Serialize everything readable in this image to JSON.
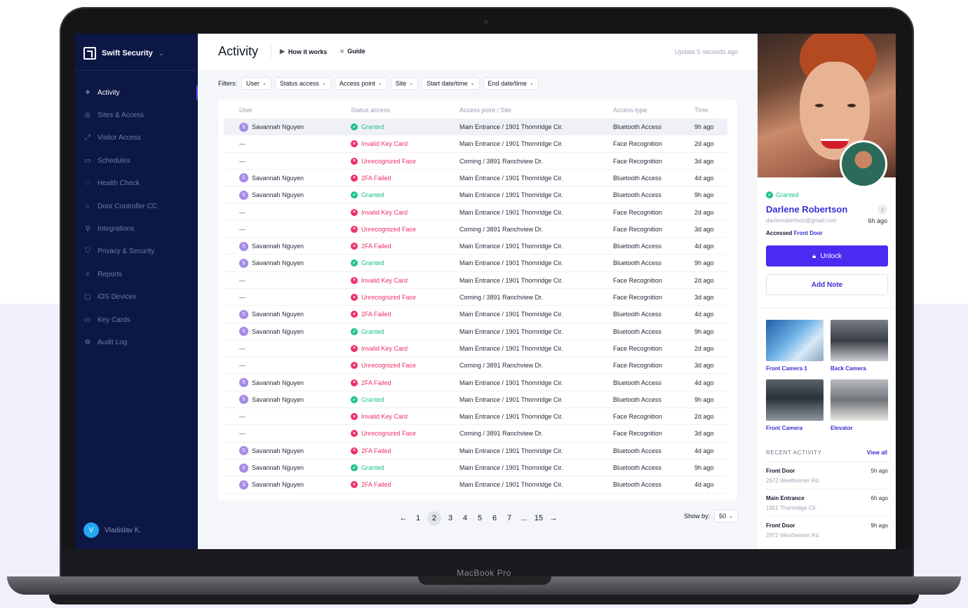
{
  "device_label": "MacBook Pro",
  "brand": {
    "name": "Swift Security"
  },
  "nav": [
    {
      "label": "Activity",
      "icon": "activity-icon",
      "glyph": "✧",
      "active": true
    },
    {
      "label": "Sites & Access",
      "icon": "location-icon",
      "glyph": "◎"
    },
    {
      "label": "Visitor Access",
      "icon": "visitor-icon",
      "glyph": "⤢"
    },
    {
      "label": "Schedules",
      "icon": "calendar-icon",
      "glyph": "▭"
    },
    {
      "label": "Health Check",
      "icon": "heart-icon",
      "glyph": "♡"
    },
    {
      "label": "Door Controller CC",
      "icon": "lock-icon",
      "glyph": "⌂"
    },
    {
      "label": "Integrations",
      "icon": "plug-icon",
      "glyph": "⚲"
    },
    {
      "label": "Privacy & Security",
      "icon": "shield-icon",
      "glyph": "⛉"
    },
    {
      "label": "Reports",
      "icon": "reports-icon",
      "glyph": "✧"
    },
    {
      "label": "iOS Devices",
      "icon": "device-icon",
      "glyph": "▢"
    },
    {
      "label": "Key Cards",
      "icon": "card-icon",
      "glyph": "▭"
    },
    {
      "label": "Audit Log",
      "icon": "gear-icon",
      "glyph": "⚙"
    }
  ],
  "current_user": {
    "initial": "V",
    "name": "Vladislav K."
  },
  "header": {
    "title": "Activity",
    "how_it_works": "How it works",
    "guide": "Guide",
    "update_status": "Update 5 seconds ago"
  },
  "filters": {
    "label": "Filters:",
    "chips": [
      "User",
      "Status access",
      "Access point",
      "Site",
      "Start date/time",
      "End date/time"
    ]
  },
  "table": {
    "columns": [
      "User",
      "Status access",
      "Access point / Site",
      "Access type",
      "Time"
    ],
    "rows": [
      {
        "user": "Savannah Nguyen",
        "initial": "S",
        "status": "Granted",
        "kind": "ok",
        "point": "Main Entrance / 1901 Thornridge Cir.",
        "type": "Bluetooth Access",
        "time": "9h ago"
      },
      {
        "user": "—",
        "initial": "",
        "status": "Invalid Key Card",
        "kind": "bad",
        "point": "Main Entrance / 1901 Thornridge Cir.",
        "type": "Face Recognition",
        "time": "2d ago"
      },
      {
        "user": "—",
        "initial": "",
        "status": "Unrecognized Face",
        "kind": "bad",
        "point": "Coming / 3891 Ranchview Dr.",
        "type": "Face Recognition",
        "time": "3d ago"
      },
      {
        "user": "Savannah Nguyen",
        "initial": "S",
        "status": "2FA Failed",
        "kind": "bad",
        "point": "Main Entrance / 1901 Thornridge Cir.",
        "type": "Bluetooth Access",
        "time": "4d ago"
      },
      {
        "user": "Savannah Nguyen",
        "initial": "S",
        "status": "Granted",
        "kind": "ok",
        "point": "Main Entrance / 1901 Thornridge Cir.",
        "type": "Bluetooth Access",
        "time": "9h ago"
      },
      {
        "user": "—",
        "initial": "",
        "status": "Invalid Key Card",
        "kind": "bad",
        "point": "Main Entrance / 1901 Thornridge Cir.",
        "type": "Face Recognition",
        "time": "2d ago"
      },
      {
        "user": "—",
        "initial": "",
        "status": "Unrecognized Face",
        "kind": "bad",
        "point": "Coming / 3891 Ranchview Dr.",
        "type": "Face Recognition",
        "time": "3d ago"
      },
      {
        "user": "Savannah Nguyen",
        "initial": "S",
        "status": "2FA Failed",
        "kind": "bad",
        "point": "Main Entrance / 1901 Thornridge Cir.",
        "type": "Bluetooth Access",
        "time": "4d ago"
      },
      {
        "user": "Savannah Nguyen",
        "initial": "S",
        "status": "Granted",
        "kind": "ok",
        "point": "Main Entrance / 1901 Thornridge Cir.",
        "type": "Bluetooth Access",
        "time": "9h ago"
      },
      {
        "user": "—",
        "initial": "",
        "status": "Invalid Key Card",
        "kind": "bad",
        "point": "Main Entrance / 1901 Thornridge Cir.",
        "type": "Face Recognition",
        "time": "2d ago"
      },
      {
        "user": "—",
        "initial": "",
        "status": "Unrecognized Face",
        "kind": "bad",
        "point": "Coming / 3891 Ranchview Dr.",
        "type": "Face Recognition",
        "time": "3d ago"
      },
      {
        "user": "Savannah Nguyen",
        "initial": "S",
        "status": "2FA Failed",
        "kind": "bad",
        "point": "Main Entrance / 1901 Thornridge Cir.",
        "type": "Bluetooth Access",
        "time": "4d ago"
      },
      {
        "user": "Savannah Nguyen",
        "initial": "S",
        "status": "Granted",
        "kind": "ok",
        "point": "Main Entrance / 1901 Thornridge Cir.",
        "type": "Bluetooth Access",
        "time": "9h ago"
      },
      {
        "user": "—",
        "initial": "",
        "status": "Invalid Key Card",
        "kind": "bad",
        "point": "Main Entrance / 1901 Thornridge Cir.",
        "type": "Face Recognition",
        "time": "2d ago"
      },
      {
        "user": "—",
        "initial": "",
        "status": "Unrecognized Face",
        "kind": "bad",
        "point": "Coming / 3891 Ranchview Dr.",
        "type": "Face Recognition",
        "time": "3d ago"
      },
      {
        "user": "Savannah Nguyen",
        "initial": "S",
        "status": "2FA Failed",
        "kind": "bad",
        "point": "Main Entrance / 1901 Thornridge Cir.",
        "type": "Bluetooth Access",
        "time": "4d ago"
      },
      {
        "user": "Savannah Nguyen",
        "initial": "S",
        "status": "Granted",
        "kind": "ok",
        "point": "Main Entrance / 1901 Thornridge Cir.",
        "type": "Bluetooth Access",
        "time": "9h ago"
      },
      {
        "user": "—",
        "initial": "",
        "status": "Invalid Key Card",
        "kind": "bad",
        "point": "Main Entrance / 1901 Thornridge Cir.",
        "type": "Face Recognition",
        "time": "2d ago"
      },
      {
        "user": "—",
        "initial": "",
        "status": "Unrecognized Face",
        "kind": "bad",
        "point": "Coming / 3891 Ranchview Dr.",
        "type": "Face Recognition",
        "time": "3d ago"
      },
      {
        "user": "Savannah Nguyen",
        "initial": "S",
        "status": "2FA Failed",
        "kind": "bad",
        "point": "Main Entrance / 1901 Thornridge Cir.",
        "type": "Bluetooth Access",
        "time": "4d ago"
      },
      {
        "user": "Savannah Nguyen",
        "initial": "S",
        "status": "Granted",
        "kind": "ok",
        "point": "Main Entrance / 1901 Thornridge Cir.",
        "type": "Bluetooth Access",
        "time": "9h ago"
      },
      {
        "user": "Savannah Nguyen",
        "initial": "S",
        "status": "2FA Failed",
        "kind": "bad",
        "point": "Main Entrance / 1901 Thornridge Cir.",
        "type": "Bluetooth Access",
        "time": "4d ago"
      }
    ]
  },
  "pagination": {
    "prev": "←",
    "next": "→",
    "pages": [
      "1",
      "2",
      "3",
      "4",
      "5",
      "6",
      "7",
      "...",
      "15"
    ],
    "current": "2",
    "show_by_label": "Show by:",
    "show_by_value": "50"
  },
  "detail": {
    "status": "Granted",
    "name": "Darlene Robertson",
    "email": "darlenrobertson@gmail.com",
    "time": "6h ago",
    "accessed_label": "Accessed",
    "accessed_location": "Front Door",
    "unlock_label": "Unlock",
    "add_note_label": "Add Note",
    "info_glyph": "i",
    "cameras": [
      "Front Camera 1",
      "Back Camera",
      "Front Camera",
      "Elevator"
    ],
    "recent_title": "RECENT ACTIVITY",
    "view_all": "View all",
    "recent": [
      {
        "place": "Front Door",
        "address": "2972 Westheimer Rd.",
        "time": "5h ago"
      },
      {
        "place": "Main Entrance",
        "address": "1901 Thornridge Cir.",
        "time": "6h ago"
      },
      {
        "place": "Front Door",
        "address": "2972 Westheimer Rd.",
        "time": "9h ago"
      }
    ]
  },
  "colors": {
    "sidebar_bg": "#0c1746",
    "accent": "#4a2bf2",
    "granted": "#1cc18a",
    "denied": "#ee2f63"
  }
}
